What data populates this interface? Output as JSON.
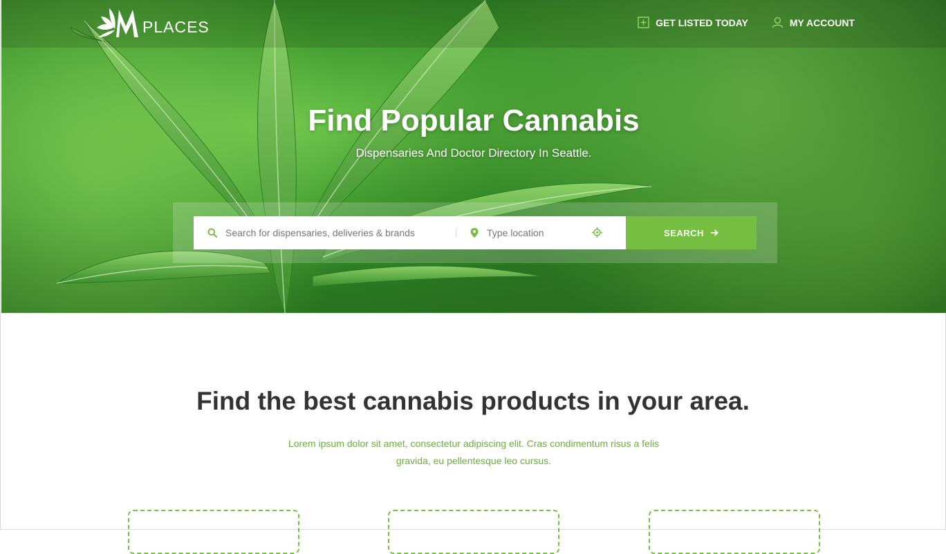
{
  "brand": {
    "logo_text": "PLACES",
    "accent_color": "#77bf43"
  },
  "nav": {
    "items": [
      {
        "label": "GET LISTED TODAY",
        "icon": "plus-square-icon"
      },
      {
        "label": "MY ACCOUNT",
        "icon": "user-icon"
      }
    ]
  },
  "hero": {
    "title": "Find Popular Cannabis",
    "subtitle": "Dispensaries And Doctor Directory In Seattle."
  },
  "search": {
    "query_placeholder": "Search for dispensaries, deliveries & brands",
    "location_placeholder": "Type location",
    "button_label": "SEARCH",
    "icons": [
      "search-icon",
      "map-pin-icon",
      "crosshair-icon",
      "arrow-right-icon"
    ]
  },
  "section": {
    "title": "Find the best cannabis products in your area.",
    "line1": "Lorem ipsum dolor sit amet, consectetur adipiscing elit. Cras condimentum risus a felis",
    "line2": "gravida, eu pellentesque leo cursus."
  }
}
